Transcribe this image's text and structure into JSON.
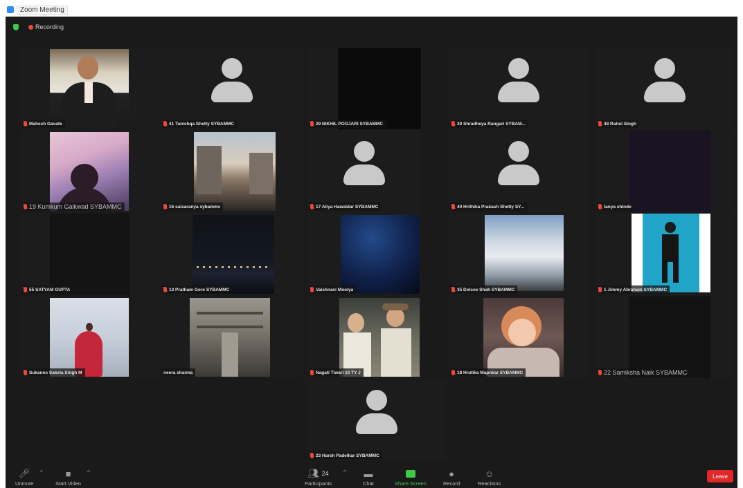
{
  "window": {
    "title": "Zoom Meeting"
  },
  "recording": {
    "label": "Recording"
  },
  "participants": [
    {
      "name": "Mahesh Gavate",
      "video": "photo-man-suit"
    },
    {
      "name": "41 Tanishqa Shetty SYBAMMC",
      "video": "avatar"
    },
    {
      "name": "29 NIKHIL POOJARI SYBAMMC",
      "video": "black"
    },
    {
      "name": "30 Shradheya Rangari SYBAM...",
      "video": "avatar"
    },
    {
      "name": "48 Rahul Singh",
      "video": "avatar"
    },
    {
      "name": "19 Kumkum Gaikwad SYBAMMC",
      "video": "photo-silhouette-sky"
    },
    {
      "name": "16 saisaranya sybammc",
      "video": "photo-street"
    },
    {
      "name": "17 Aliya Hawaldar SYBAMMC",
      "video": "avatar"
    },
    {
      "name": "40 Hrithika Prakash Shetty SY...",
      "video": "avatar"
    },
    {
      "name": "tanya shinde",
      "video": "dark"
    },
    {
      "name": "55 SATYAM GUPTA",
      "video": "dark"
    },
    {
      "name": "13 Pratham Gore SYBAMMC",
      "video": "photo-night-city"
    },
    {
      "name": "Vaishnavi Moolya",
      "video": "photo-blue-sky"
    },
    {
      "name": "35 Dolcee Shah SYBAMMC",
      "video": "photo-clouds"
    },
    {
      "name": "1 Jimmy Abraham SYBAMMC",
      "video": "photo-person-cyan"
    },
    {
      "name": "Sukanns Sakela Singh M",
      "video": "photo-woman-red-dress"
    },
    {
      "name": "neera sharma",
      "video": "photo-temple"
    },
    {
      "name": "Nagati Tiwari 10 TY J",
      "video": "photo-two-men"
    },
    {
      "name": "18 Hrutika Mapnkar SYBAMMC",
      "video": "photo-animated-girl"
    },
    {
      "name": "22 Samiksha Naik SYBAMMC",
      "video": "dark"
    },
    {
      "name": "23 Harsh Padelkar SYBAMMC",
      "video": "avatar"
    }
  ],
  "toolbar": {
    "unmute": "Unmute",
    "start_video": "Start Video",
    "participants_label": "Participants",
    "participants_count": "24",
    "chat": "Chat",
    "share_screen": "Share Screen",
    "record": "Record",
    "reactions": "Reactions",
    "leave": "Leave"
  },
  "colors": {
    "background": "#1a1a1a",
    "muted_red": "#e84b3c",
    "share_green": "#3ec948",
    "leave_red": "#e02828"
  }
}
